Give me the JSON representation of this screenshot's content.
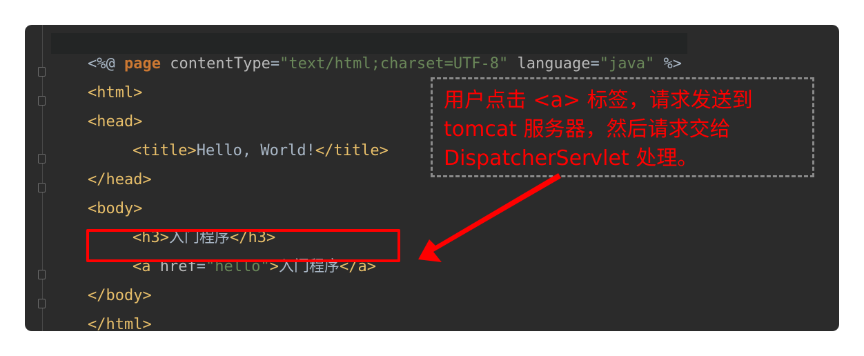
{
  "code": {
    "lines": [
      {
        "parts": [
          "<%@ ",
          "page",
          " contentType",
          "=",
          "\"text/html;charset=UTF-8\"",
          " language",
          "=",
          "\"java\"",
          " %>"
        ]
      },
      {
        "parts": [
          "<html>"
        ]
      },
      {
        "parts": [
          "<head>"
        ]
      },
      {
        "parts": [
          "<title>",
          "Hello, World!",
          "</title>"
        ]
      },
      {
        "parts": [
          "</head>"
        ]
      },
      {
        "parts": [
          "<body>"
        ]
      },
      {
        "parts": [
          "<h3>",
          "入门程序",
          "</h3>"
        ]
      },
      {
        "parts": [
          "<a ",
          "href",
          "=",
          "\"hello\"",
          ">",
          "入门程序",
          "</a>"
        ]
      },
      {
        "parts": [
          "</body>"
        ]
      },
      {
        "parts": [
          "</html>"
        ]
      }
    ]
  },
  "annotation": {
    "text_lines": [
      "用户点击 <a> 标签，请求发送到",
      "tomcat 服务器，然后请求交给",
      "DispatcherServlet 处理。"
    ],
    "color": "#ff0000"
  },
  "theme": {
    "background": "#2b2b2b",
    "tag_color": "#e8bf6a",
    "string_color": "#6a8759",
    "keyword_color": "#cc7832"
  }
}
